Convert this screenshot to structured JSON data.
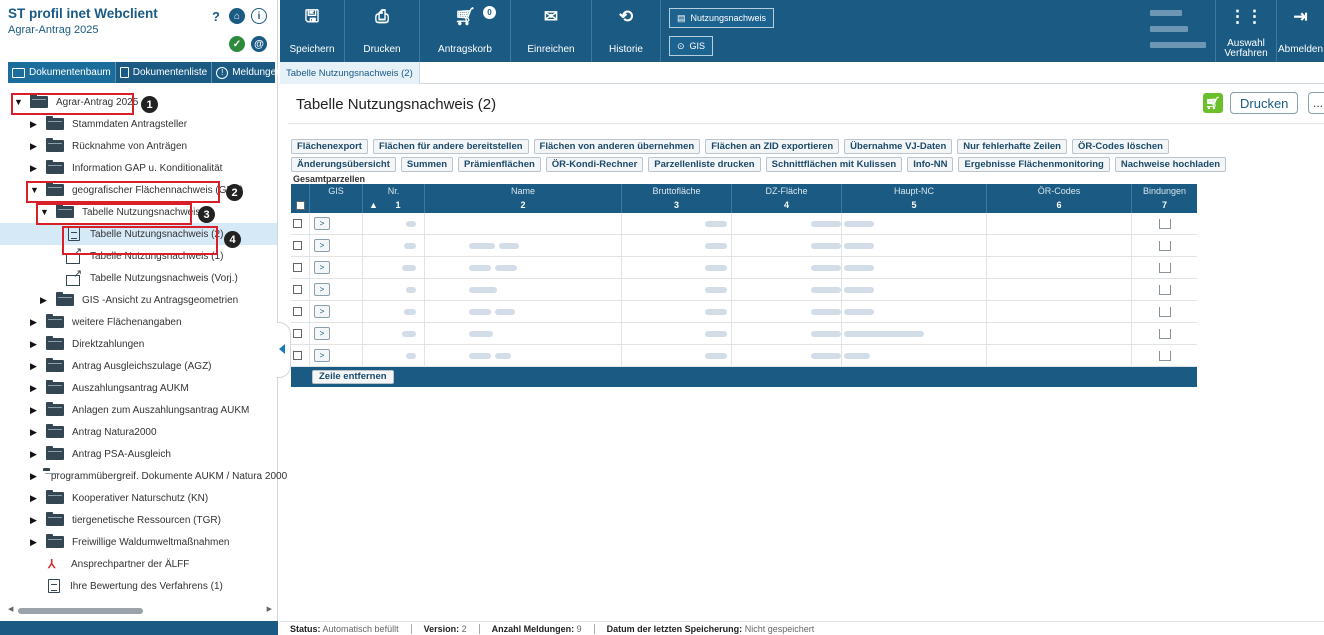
{
  "app": {
    "title": "ST profil inet Webclient",
    "subtitle": "Agrar-Antrag 2025",
    "help": "?"
  },
  "doc_tabs": [
    "Dokumentenbaum",
    "Dokumentenliste",
    "Meldungen"
  ],
  "tree": {
    "root": "Agrar-Antrag 2025",
    "items": [
      "Stammdaten Antragsteller",
      "Rücknahme von Anträgen",
      "Information GAP u. Konditionalität",
      "geografischer Flächennachweis (GFN)",
      "Tabelle Nutzungsnachweis",
      "Tabelle Nutzungsnachweis (2)",
      "Tabelle Nutzungsnachweis (1)",
      "Tabelle Nutzungsnachweis (Vorj.)",
      "GIS -Ansicht zu Antragsgeometrien",
      "weitere Flächenangaben",
      "Direktzahlungen",
      "Antrag Ausgleichszulage (AGZ)",
      "Auszahlungsantrag AUKM",
      "Anlagen zum Auszahlungsantrag AUKM",
      "Antrag Natura2000",
      "Antrag PSA-Ausgleich",
      "programmübergreif. Dokumente AUKM / Natura 2000",
      "Kooperativer Naturschutz (KN)",
      "tiergenetische Ressourcen (TGR)",
      "Freiwillige Waldumweltmaßnahmen",
      "Ansprechpartner der ÄLFF",
      "Ihre Bewertung des Verfahrens (1)"
    ],
    "badges": [
      "1",
      "2",
      "3",
      "4"
    ]
  },
  "toolbar": {
    "save": "Speichern",
    "print": "Drucken",
    "cart": "Antragskorb",
    "cart_count": "0",
    "submit": "Einreichen",
    "history": "Historie",
    "nutzungsnachweis": "Nutzungsnachweis",
    "gis": "GIS",
    "auswahl_line1": "Auswahl",
    "auswahl_line2": "Verfahren",
    "logout": "Abmelden"
  },
  "content": {
    "tab": "Tabelle Nutzungsnachweis (2)",
    "title": "Tabelle Nutzungsnachweis (2)",
    "print": "Drucken",
    "more": "..."
  },
  "actions_row1": [
    "Flächenexport",
    "Flächen für andere bereitstellen",
    "Flächen von anderen übernehmen",
    "Flächen an ZID exportieren",
    "Übernahme VJ-Daten",
    "Nur fehlerhafte Zeilen",
    "ÖR-Codes löschen"
  ],
  "actions_row2": [
    "Änderungsübersicht",
    "Summen",
    "Prämienflächen",
    "ÖR-Kondi-Rechner",
    "Parzellenliste drucken",
    "Schnittflächen mit Kulissen",
    "Info-NN",
    "Ergebnisse Flächenmonitoring",
    "Nachweise hochladen"
  ],
  "grid": {
    "caption": "Gesamtparzellen",
    "columns": [
      "GIS",
      "Nr.",
      "Name",
      "Bruttofläche",
      "DZ-Fläche",
      "Haupt-NC",
      "ÖR-Codes",
      "Bindungen"
    ],
    "numbers": [
      "1",
      "2",
      "3",
      "4",
      "5",
      "6",
      "7"
    ],
    "row_count": 7,
    "gis_button": ">",
    "remove_row": "Zeile entfernen"
  },
  "status": {
    "status_label": "Status:",
    "status_value": "Automatisch befüllt",
    "version_label": "Version:",
    "version_value": "2",
    "messages_label": "Anzahl Meldungen:",
    "messages_value": "9",
    "saved_label": "Datum der letzten Speicherung:",
    "saved_value": "Nicht gespeichert"
  }
}
